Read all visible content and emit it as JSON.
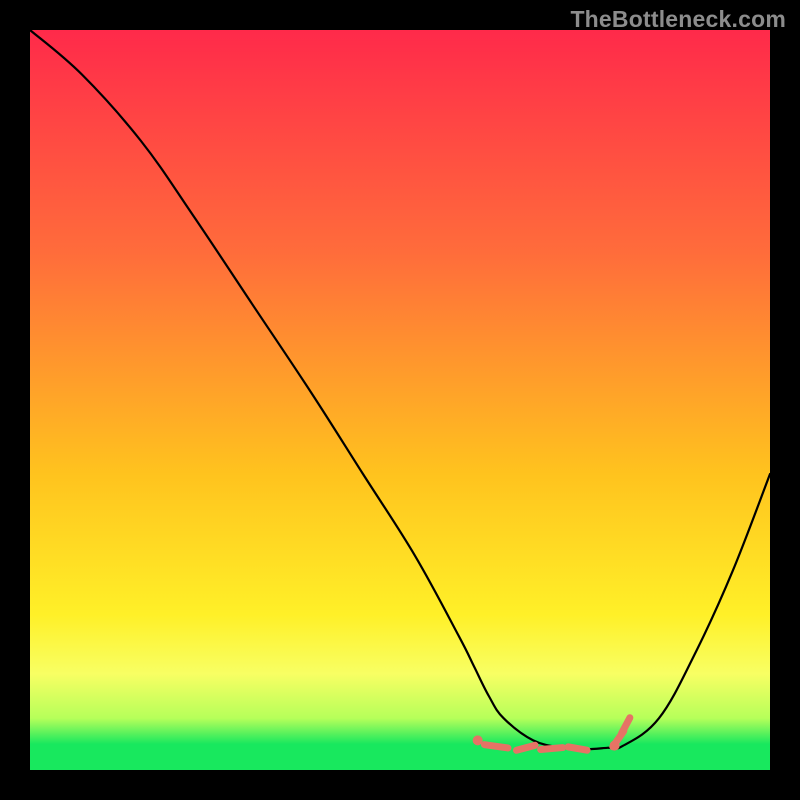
{
  "watermark": "TheBottleneck.com",
  "colors": {
    "gradient": {
      "c0": "#ff2a4a",
      "c1": "#ff6c3b",
      "c2": "#ffc31e",
      "c3": "#fff028",
      "c4": "#f8ff63",
      "c5": "#b6ff5a",
      "c6": "#18e85e"
    },
    "curve_stroke": "#000000",
    "marker_fill": "#e67365"
  },
  "chart_data": {
    "type": "line",
    "title": "",
    "xlabel": "",
    "ylabel": "",
    "xlim": [
      0,
      100
    ],
    "ylim": [
      0,
      100
    ],
    "grid": false,
    "series": [
      {
        "name": "curve",
        "x": [
          0,
          7,
          15,
          22,
          30,
          38,
          45,
          52,
          58,
          60,
          62,
          64,
          68,
          72,
          75,
          78,
          80,
          85,
          90,
          95,
          100
        ],
        "y": [
          100,
          94,
          85,
          75,
          63,
          51,
          40,
          29,
          18,
          14,
          10,
          7,
          4,
          3,
          2.8,
          3.0,
          3.2,
          7,
          16,
          27,
          40
        ]
      }
    ],
    "markers": [
      {
        "shape": "dot",
        "x": 60.5,
        "y": 4.0
      },
      {
        "shape": "dash",
        "x": 63.0,
        "y": 3.2,
        "len": 3.2,
        "angle": -8
      },
      {
        "shape": "dash",
        "x": 67.0,
        "y": 3.0,
        "len": 2.6,
        "angle": 15
      },
      {
        "shape": "dash",
        "x": 70.5,
        "y": 2.9,
        "len": 3.0,
        "angle": 5
      },
      {
        "shape": "dash",
        "x": 74.0,
        "y": 2.9,
        "len": 2.6,
        "angle": -10
      },
      {
        "shape": "dot",
        "x": 79.0,
        "y": 3.3
      },
      {
        "shape": "dash",
        "x": 79.5,
        "y": 4.2,
        "len": 2.6,
        "angle": 55
      },
      {
        "shape": "dash",
        "x": 80.5,
        "y": 6.0,
        "len": 2.4,
        "angle": 62
      }
    ]
  }
}
